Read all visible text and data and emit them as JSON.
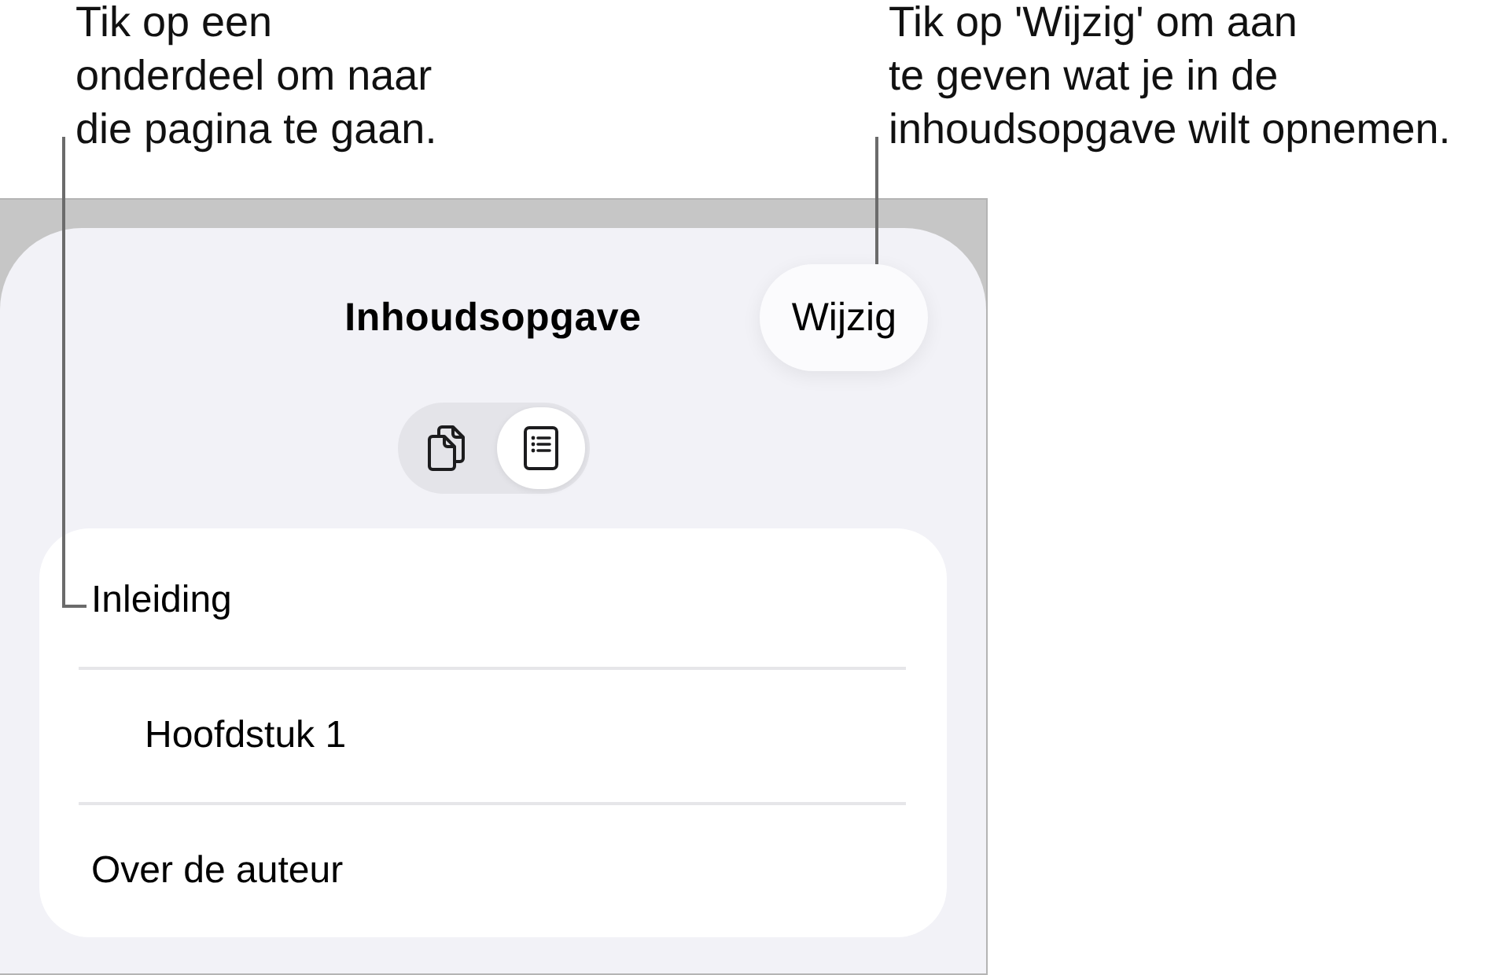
{
  "callouts": [
    {
      "text": "Tik op een\nonderdeel om naar\ndie pagina te gaan."
    },
    {
      "text": "Tik op 'Wijzig' om aan\nte geven wat je in de\ninhoudsopgave wilt opnemen."
    }
  ],
  "panel": {
    "title": "Inhoudsopgave",
    "edit_button": "Wijzig",
    "view_toggle": [
      {
        "kind": "pages",
        "selected": false
      },
      {
        "kind": "list",
        "selected": true
      }
    ],
    "toc_items": [
      {
        "label": "Inleiding",
        "children": [
          {
            "label": "Hoofdstuk 1"
          }
        ]
      },
      {
        "label": "Over de auteur"
      }
    ]
  }
}
